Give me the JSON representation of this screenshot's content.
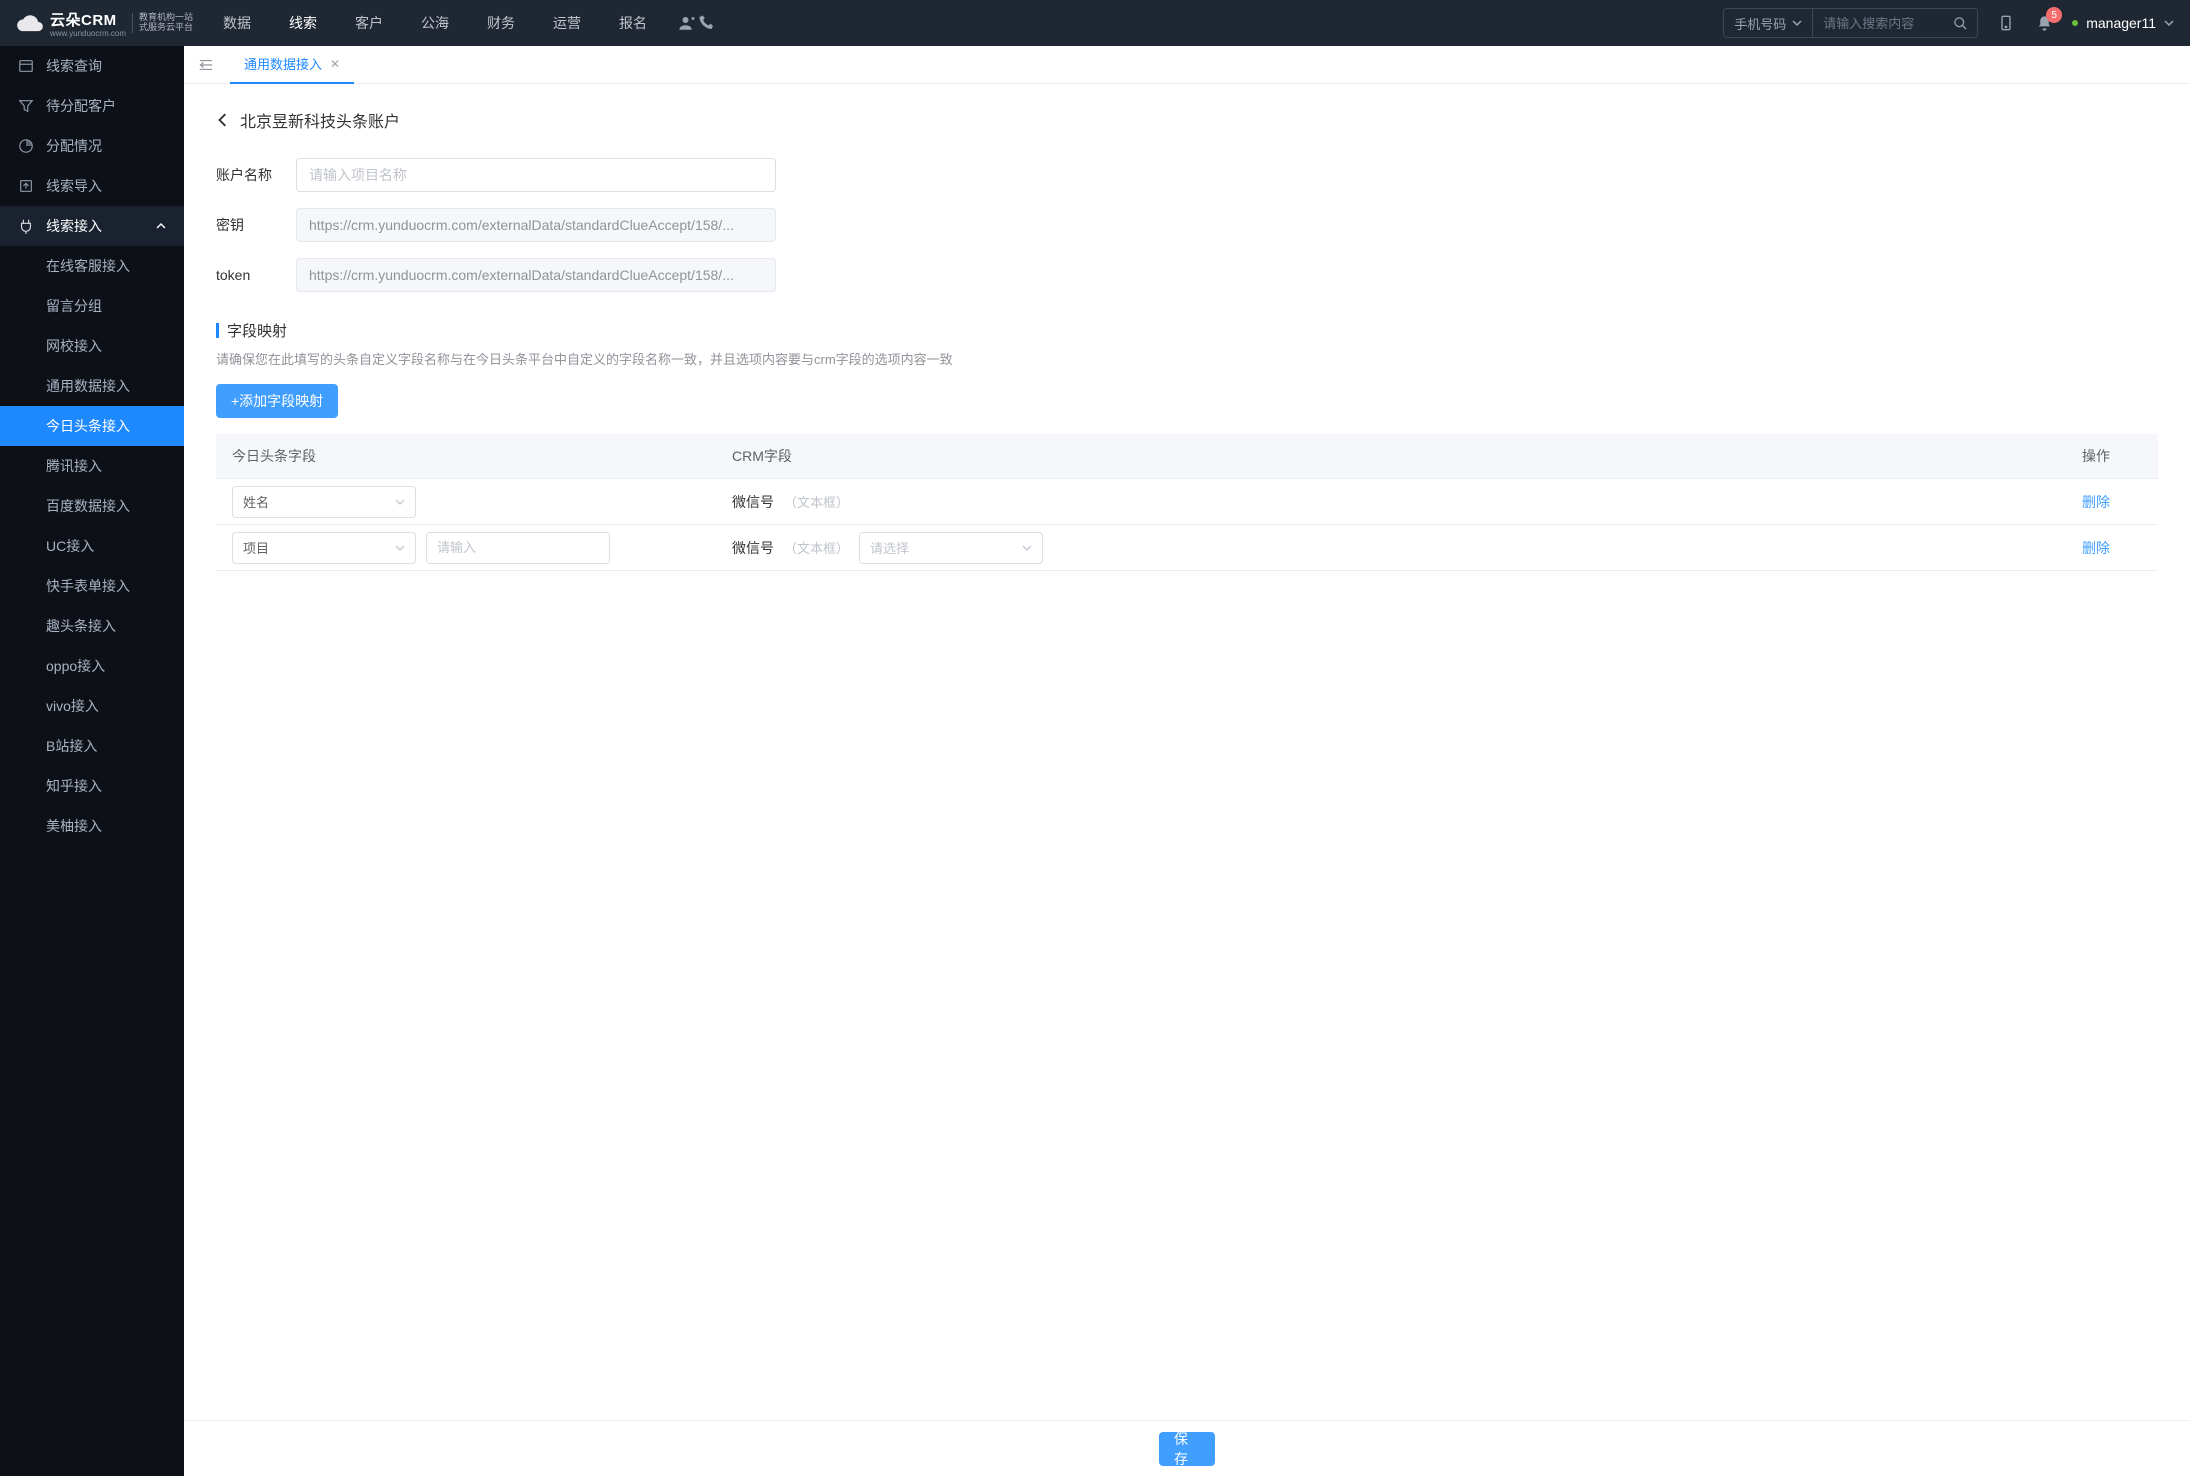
{
  "brand": {
    "name": "云朵CRM",
    "tagline1": "教育机构一站",
    "tagline2": "式服务云平台",
    "site": "www.yunduocrm.com"
  },
  "nav": [
    "数据",
    "线索",
    "客户",
    "公海",
    "财务",
    "运营",
    "报名"
  ],
  "nav_active_index": 1,
  "search": {
    "type_label": "手机号码",
    "placeholder": "请输入搜索内容"
  },
  "badge_count": "5",
  "username": "manager11",
  "sidebar": {
    "top": [
      {
        "label": "线索查询"
      },
      {
        "label": "待分配客户"
      },
      {
        "label": "分配情况"
      },
      {
        "label": "线索导入"
      }
    ],
    "expanded_label": "线索接入",
    "subs": [
      "在线客服接入",
      "留言分组",
      "网校接入",
      "通用数据接入",
      "今日头条接入",
      "腾讯接入",
      "百度数据接入",
      "UC接入",
      "快手表单接入",
      "趣头条接入",
      "oppo接入",
      "vivo接入",
      "B站接入",
      "知乎接入",
      "美柚接入"
    ],
    "active_sub_index": 4
  },
  "tabs": {
    "active": "通用数据接入"
  },
  "page": {
    "title": "北京昱新科技头条账户",
    "fields": {
      "name_label": "账户名称",
      "name_placeholder": "请输入项目名称",
      "secret_label": "密钥",
      "secret_value": "https://crm.yunduocrm.com/externalData/standardClueAccept/158/...",
      "token_label": "token",
      "token_value": "https://crm.yunduocrm.com/externalData/standardClueAccept/158/..."
    },
    "mapping": {
      "title": "字段映射",
      "desc": "请确保您在此填写的头条自定义字段名称与在今日头条平台中自定义的字段名称一致，并且选项内容要与crm字段的选项内容一致",
      "add_btn": "+添加字段映射",
      "headers": {
        "a": "今日头条字段",
        "b": "CRM字段",
        "c": "操作"
      },
      "rows": [
        {
          "field_sel": "姓名",
          "extra_input": null,
          "crm_label": "微信号",
          "crm_hint": "（文本框）",
          "crm_select": null,
          "action": "删除"
        },
        {
          "field_sel": "项目",
          "extra_input_placeholder": "请输入",
          "crm_label": "微信号",
          "crm_hint": "（文本框）",
          "crm_select_placeholder": "请选择",
          "action": "删除"
        }
      ]
    },
    "save_btn": "保存"
  }
}
